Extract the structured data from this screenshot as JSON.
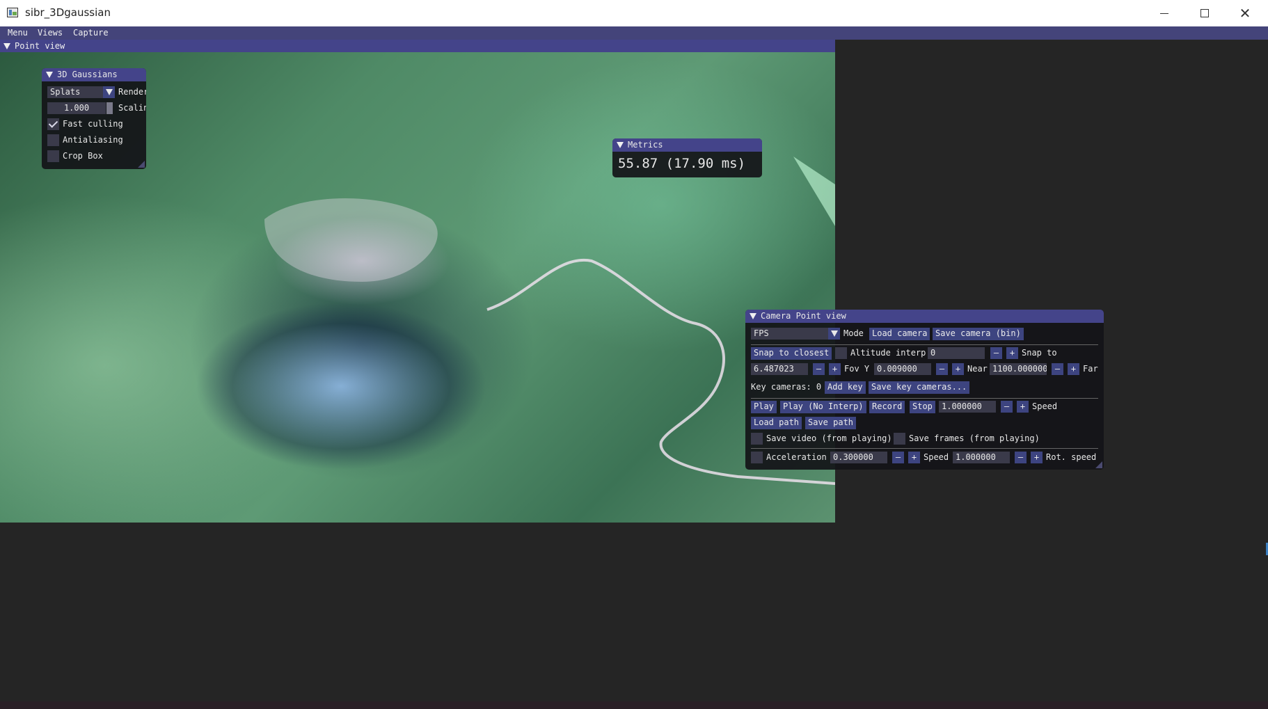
{
  "window": {
    "title": "sibr_3Dgaussian",
    "controls": {
      "minimize": "–",
      "maximize": "□",
      "close": "✕"
    }
  },
  "menubar": {
    "items": [
      "Menu",
      "Views",
      "Capture"
    ]
  },
  "point_view": {
    "title": "Point view"
  },
  "gaussians": {
    "title": "3D Gaussians",
    "render_mode": "Splats",
    "render_label": "Render",
    "scaling_value": "1.000",
    "scaling_label": "Scaling",
    "fast_culling": {
      "label": "Fast culling",
      "checked": true
    },
    "antialiasing": {
      "label": "Antialiasing",
      "checked": false
    },
    "crop_box": {
      "label": "Crop Box",
      "checked": false
    }
  },
  "metrics": {
    "title": "Metrics",
    "value": "55.87 (17.90 ms)"
  },
  "camera": {
    "title": "Camera Point view",
    "mode_value": "FPS",
    "mode_label": "Mode",
    "load_camera": "Load camera",
    "save_camera": "Save camera (bin)",
    "snap_to_closest": "Snap to closest",
    "altitude_interp_label": "Altitude interp",
    "altitude_interp_value": "0",
    "snap_to_label": "Snap to",
    "fov_value": "6.487023",
    "fov_label": "Fov Y",
    "near_value": "0.009000",
    "near_label": "Near",
    "far_value": "1100.000000",
    "far_label": "Far",
    "key_cameras": "Key cameras: 0",
    "add_key": "Add key",
    "save_key_cameras": "Save key cameras...",
    "play": "Play",
    "play_no_interp": "Play (No Interp)",
    "record": "Record",
    "stop": "Stop",
    "speed_value": "1.000000",
    "speed_label": "Speed",
    "load_path": "Load path",
    "save_path": "Save path",
    "save_video": "Save video (from playing)",
    "save_frames": "Save frames (from playing)",
    "acceleration_label": "Acceleration",
    "acceleration_value": "0.300000",
    "move_speed_label": "Speed",
    "move_speed_value": "1.000000",
    "rot_speed_label": "Rot. speed",
    "minus": "–",
    "plus": "+"
  }
}
